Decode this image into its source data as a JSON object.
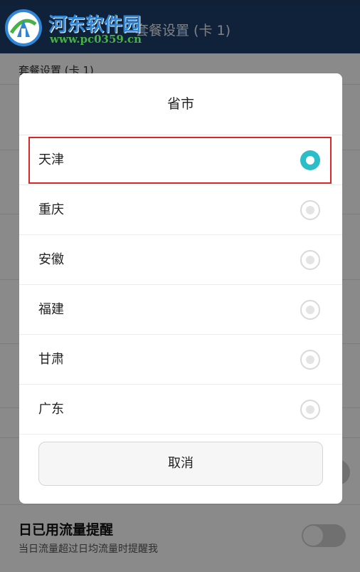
{
  "app": {
    "header_title": "套餐设置 (卡 1)",
    "section_title": "套餐设置 (卡 1)",
    "daily_alert_title": "日已用流量提醒",
    "daily_alert_subtitle": "当日流量超过日均流量时提醒我"
  },
  "watermark": {
    "site_name": "河东软件园",
    "url": "www.pc0359.cn"
  },
  "dialog": {
    "title": "省市",
    "options": [
      {
        "label": "天津",
        "selected": true
      },
      {
        "label": "重庆",
        "selected": false
      },
      {
        "label": "安徽",
        "selected": false
      },
      {
        "label": "福建",
        "selected": false
      },
      {
        "label": "甘肃",
        "selected": false
      },
      {
        "label": "广东",
        "selected": false
      }
    ],
    "cancel_label": "取消"
  },
  "colors": {
    "header_bg": "#1f3f6a",
    "radio_selected": "#2bbec8",
    "highlight_border": "#d8262b"
  }
}
